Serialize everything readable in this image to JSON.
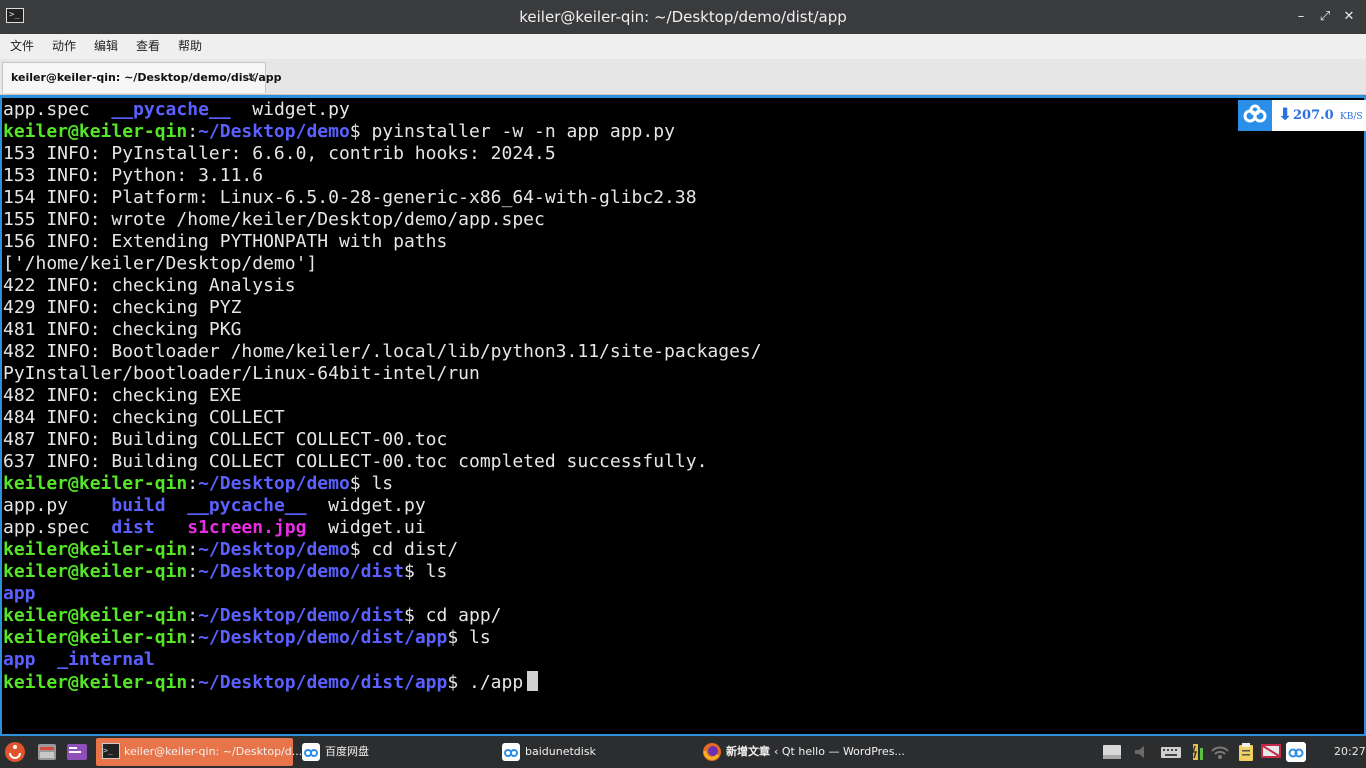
{
  "window": {
    "title": "keiler@keiler-qin: ~/Desktop/demo/dist/app",
    "icon": "terminal-icon",
    "controls": {
      "minimize": "–",
      "restore": "⤢",
      "close": "✕"
    }
  },
  "menu": [
    "文件",
    "动作",
    "编辑",
    "查看",
    "帮助"
  ],
  "tab": {
    "label": "keiler@keiler-qin: ~/Desktop/demo/dist/app",
    "close": "✕"
  },
  "terminal": {
    "lines": [
      [
        [
          "app.spec  ",
          "n"
        ],
        [
          "__pycache__",
          "d"
        ],
        [
          "  widget.py",
          "n"
        ]
      ],
      [
        [
          "keiler@keiler-qin",
          "u"
        ],
        [
          ":",
          "n"
        ],
        [
          "~/Desktop/demo",
          "p"
        ],
        [
          "$ pyinstaller -w -n app app.py",
          "n"
        ]
      ],
      [
        [
          "153 INFO: PyInstaller: 6.6.0, contrib hooks: 2024.5",
          "n"
        ]
      ],
      [
        [
          "153 INFO: Python: 3.11.6",
          "n"
        ]
      ],
      [
        [
          "154 INFO: Platform: Linux-6.5.0-28-generic-x86_64-with-glibc2.38",
          "n"
        ]
      ],
      [
        [
          "155 INFO: wrote /home/keiler/Desktop/demo/app.spec",
          "n"
        ]
      ],
      [
        [
          "156 INFO: Extending PYTHONPATH with paths",
          "n"
        ]
      ],
      [
        [
          "['/home/keiler/Desktop/demo']",
          "n"
        ]
      ],
      [
        [
          "422 INFO: checking Analysis",
          "n"
        ]
      ],
      [
        [
          "429 INFO: checking PYZ",
          "n"
        ]
      ],
      [
        [
          "481 INFO: checking PKG",
          "n"
        ]
      ],
      [
        [
          "482 INFO: Bootloader /home/keiler/.local/lib/python3.11/site-packages/",
          "n"
        ]
      ],
      [
        [
          "PyInstaller/bootloader/Linux-64bit-intel/run",
          "n"
        ]
      ],
      [
        [
          "482 INFO: checking EXE",
          "n"
        ]
      ],
      [
        [
          "484 INFO: checking COLLECT",
          "n"
        ]
      ],
      [
        [
          "487 INFO: Building COLLECT COLLECT-00.toc",
          "n"
        ]
      ],
      [
        [
          "637 INFO: Building COLLECT COLLECT-00.toc completed successfully.",
          "n"
        ]
      ],
      [
        [
          "keiler@keiler-qin",
          "u"
        ],
        [
          ":",
          "n"
        ],
        [
          "~/Desktop/demo",
          "p"
        ],
        [
          "$ ls",
          "n"
        ]
      ],
      [
        [
          "app.py    ",
          "n"
        ],
        [
          "build",
          "d"
        ],
        [
          "  ",
          "n"
        ],
        [
          "__pycache__",
          "d"
        ],
        [
          "  widget.py",
          "n"
        ]
      ],
      [
        [
          "app.spec  ",
          "n"
        ],
        [
          "dist",
          "d"
        ],
        [
          "   ",
          "n"
        ],
        [
          "s1creen.jpg",
          "img"
        ],
        [
          "  widget.ui",
          "n"
        ]
      ],
      [
        [
          "keiler@keiler-qin",
          "u"
        ],
        [
          ":",
          "n"
        ],
        [
          "~/Desktop/demo",
          "p"
        ],
        [
          "$ cd dist/",
          "n"
        ]
      ],
      [
        [
          "keiler@keiler-qin",
          "u"
        ],
        [
          ":",
          "n"
        ],
        [
          "~/Desktop/demo/dist",
          "p"
        ],
        [
          "$ ls",
          "n"
        ]
      ],
      [
        [
          "app",
          "d"
        ]
      ],
      [
        [
          "keiler@keiler-qin",
          "u"
        ],
        [
          ":",
          "n"
        ],
        [
          "~/Desktop/demo/dist",
          "p"
        ],
        [
          "$ cd app/",
          "n"
        ]
      ],
      [
        [
          "keiler@keiler-qin",
          "u"
        ],
        [
          ":",
          "n"
        ],
        [
          "~/Desktop/demo/dist/app",
          "p"
        ],
        [
          "$ ls",
          "n"
        ]
      ],
      [
        [
          "app",
          "d"
        ],
        [
          "  ",
          "n"
        ],
        [
          "_internal",
          "d"
        ]
      ],
      [
        [
          "keiler@keiler-qin",
          "u"
        ],
        [
          ":",
          "n"
        ],
        [
          "~/Desktop/demo/dist/app",
          "p"
        ],
        [
          "$ ./app",
          "n"
        ]
      ]
    ]
  },
  "speed_widget": {
    "icon": "baidu-cloud-icon",
    "arrow": "⬇",
    "value": "207.0",
    "unit": "KB/S"
  },
  "taskbar": {
    "tasks": [
      {
        "label": "keiler@keiler-qin: ~/Desktop/d...",
        "icon": "terminal-icon"
      },
      {
        "label": "百度网盘",
        "icon": "baidu-cloud-icon"
      },
      {
        "label": "baidunetdisk",
        "icon": "baidu-cloud-icon"
      },
      {
        "label_bold": "新增文章",
        "label": " ‹ Qt hello — WordPres...",
        "icon": "firefox-icon"
      }
    ],
    "clock": "20:27"
  },
  "colors": {
    "prompt_user": "#55e628",
    "prompt_path": "#5b60ff",
    "directory": "#5b60ff",
    "image_file": "#e82ee4",
    "focus_border": "#2f8fd8",
    "active_task": "#e8744a"
  }
}
